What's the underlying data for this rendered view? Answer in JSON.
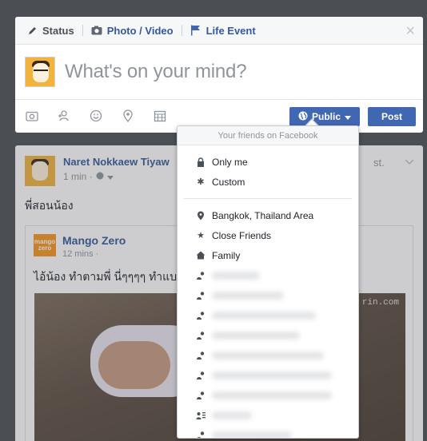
{
  "composer": {
    "tabs": [
      {
        "label": "Status",
        "icon": "pencil-icon"
      },
      {
        "label": "Photo / Video",
        "icon": "camera-icon"
      },
      {
        "label": "Life Event",
        "icon": "flag-icon"
      }
    ],
    "placeholder": "What's on your mind?",
    "tools": [
      "camera-icon",
      "tag-person-icon",
      "smiley-icon",
      "location-pin-icon",
      "calendar-icon"
    ],
    "audience_label": "Public",
    "post_label": "Post"
  },
  "post": {
    "author": "Naret Nokkaew Tiyaw",
    "author_suffix": "st.",
    "time": "1 min ·",
    "text": "พี่สอนน้อง",
    "shared": {
      "page_name": "Mango Zero",
      "logo_text": "mango zero",
      "time": "12 mins ·",
      "text": "ไอ้น้อง ทำตามพี่ นี่ๆๆๆๆ ทำแบบ",
      "watermark": "rin.com"
    }
  },
  "dropdown": {
    "header": "Your friends on Facebook",
    "items": [
      {
        "label": "Only me",
        "icon": "lock-icon"
      },
      {
        "label": "Custom",
        "icon": "gear-icon"
      }
    ],
    "lists": [
      {
        "label": "Bangkok, Thailand Area",
        "icon": "location-pin-icon"
      },
      {
        "label": "Close Friends",
        "icon": "star-icon"
      },
      {
        "label": "Family",
        "icon": "house-icon"
      }
    ]
  },
  "colors": {
    "brand_blue": "#4267b2",
    "link_blue": "#365899",
    "backdrop": "#4b4e53"
  }
}
